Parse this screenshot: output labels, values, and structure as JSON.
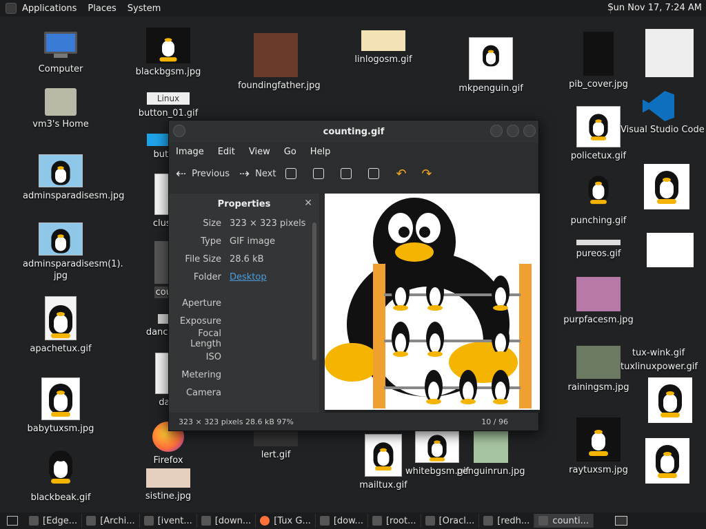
{
  "top_panel": {
    "menus": [
      "Applications",
      "Places",
      "System"
    ],
    "clock": "Sun Nov 17,  7:24 AM"
  },
  "desktop": {
    "icons": [
      {
        "label": "Computer"
      },
      {
        "label": "vm3's Home"
      },
      {
        "label": "adminsparadisesm.jpg"
      },
      {
        "label": "adminsparadisesm(1).\njpg"
      },
      {
        "label": "apachetux.gif"
      },
      {
        "label": "babytuxsm.jpg"
      },
      {
        "label": "blackbeak.gif"
      },
      {
        "label": "blackbgsm.jpg"
      },
      {
        "label": "button_01.gif"
      },
      {
        "label": "button"
      },
      {
        "label": "cluster"
      },
      {
        "label": "count"
      },
      {
        "label": "dancpeng"
      },
      {
        "label": "davi"
      },
      {
        "label": "Firefox"
      },
      {
        "label": "sistine.jpg"
      },
      {
        "label": "foundingfather.jpg"
      },
      {
        "label": "lert.gif"
      },
      {
        "label": "linlogosm.gif"
      },
      {
        "label": "mkpenguin.gif"
      },
      {
        "label": "mailtux.gif"
      },
      {
        "label": "whitebgsm.gif"
      },
      {
        "label": "penguinrun.jpg"
      },
      {
        "label": "pib_cover.jpg"
      },
      {
        "label": "policetux.gif"
      },
      {
        "label": "punching.gif"
      },
      {
        "label": "pureos.gif"
      },
      {
        "label": "purpfacesm.jpg"
      },
      {
        "label": "rainingsm.jpg"
      },
      {
        "label": "raytuxsm.jpg"
      },
      {
        "label": "Visual Studio Code"
      },
      {
        "label": "tuxlinuxpower.gif"
      },
      {
        "label": "tux-wink.gif"
      }
    ]
  },
  "window": {
    "title": "counting.gif",
    "menu": [
      "Image",
      "Edit",
      "View",
      "Go",
      "Help"
    ],
    "toolbar": {
      "previous": "Previous",
      "next": "Next"
    },
    "properties": {
      "title": "Properties",
      "rows": [
        {
          "k": "Size",
          "v": "323 × 323 pixels"
        },
        {
          "k": "Type",
          "v": "GIF image"
        },
        {
          "k": "File Size",
          "v": "28.6 kB"
        },
        {
          "k": "Folder",
          "v": "Desktop"
        },
        {
          "k": "Aperture",
          "v": ""
        },
        {
          "k": "Exposure",
          "v": ""
        },
        {
          "k": "Focal Length",
          "v": ""
        },
        {
          "k": "ISO",
          "v": ""
        },
        {
          "k": "Metering",
          "v": ""
        },
        {
          "k": "Camera",
          "v": ""
        }
      ]
    },
    "status": {
      "left": "323 × 323 pixels  28.6 kB   97%",
      "right": "10 / 96"
    }
  },
  "taskbar": {
    "tasks": [
      "[Edge...",
      "[Archi...",
      "[ivent...",
      "[down...",
      "[Tux G...",
      "[dow...",
      "[root...",
      "[Oracl...",
      "[redh...",
      "counti..."
    ]
  }
}
